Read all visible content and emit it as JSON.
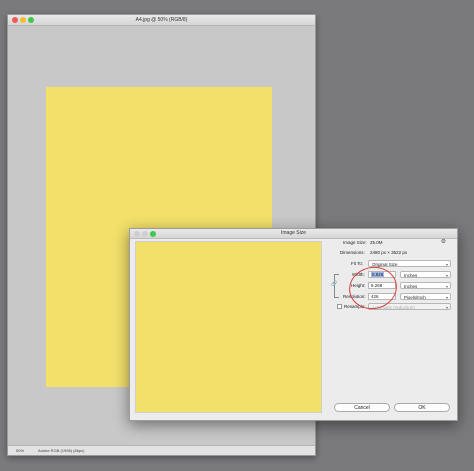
{
  "document": {
    "title": "A4.jpg @ 50% (RGB/8)",
    "status_zoom": "50%",
    "status_profile": "Adobe RGB (1998) (8bpc)"
  },
  "dialog": {
    "title": "Image Size",
    "image_size_label": "Image Size:",
    "image_size_value": "25.0M",
    "dimensions_label": "Dimensions:",
    "dimensions_value": "2480 px × 3522 px",
    "fit_to_label": "Fit To:",
    "fit_to_value": "Original Size",
    "width_label": "Width:",
    "width_value": "5.826",
    "width_unit": "Inches",
    "height_label": "Height:",
    "height_value": "8.268",
    "height_unit": "Inches",
    "resolution_label": "Resolution:",
    "resolution_value": "426",
    "resolution_unit": "Pixels/Inch",
    "resample_label": "Resample:",
    "resample_value": "Automatic (reduction)",
    "cancel_label": "Cancel",
    "ok_label": "OK"
  },
  "colors": {
    "page_yellow": "#f2e06a",
    "annotation_red": "#d94040"
  },
  "icons": [
    "gear-icon",
    "chain-link-icon",
    "chevron-down-icon"
  ]
}
